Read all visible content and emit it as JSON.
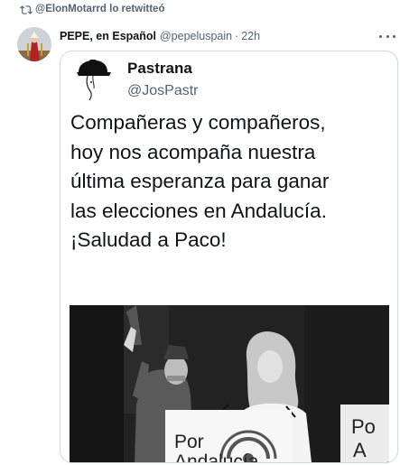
{
  "retweet": {
    "icon": "retweet-icon",
    "text": "@ElonMotarrd lo retwitteó"
  },
  "tweet": {
    "author_name": "PEPE, en Español",
    "author_handle": "@pepeluspain",
    "separator": "·",
    "time": "22h",
    "more_icon": "more-options-icon"
  },
  "quoted": {
    "author_name": "Pastrana",
    "author_handle": "@JosPastr",
    "text_lines": [
      "Compañeras y compañeros,",
      "hoy nos acompaña nuestra",
      "última esperanza para ganar",
      "las elecciones en Andalucía.",
      "¡Saludad a Paco!"
    ],
    "image": {
      "sign_text": [
        "Por",
        "Andalucía"
      ],
      "side_text": [
        "Po",
        "A"
      ]
    }
  },
  "colors": {
    "text_primary": "#0f1419",
    "text_secondary": "#536471",
    "border": "#cfd9de"
  }
}
